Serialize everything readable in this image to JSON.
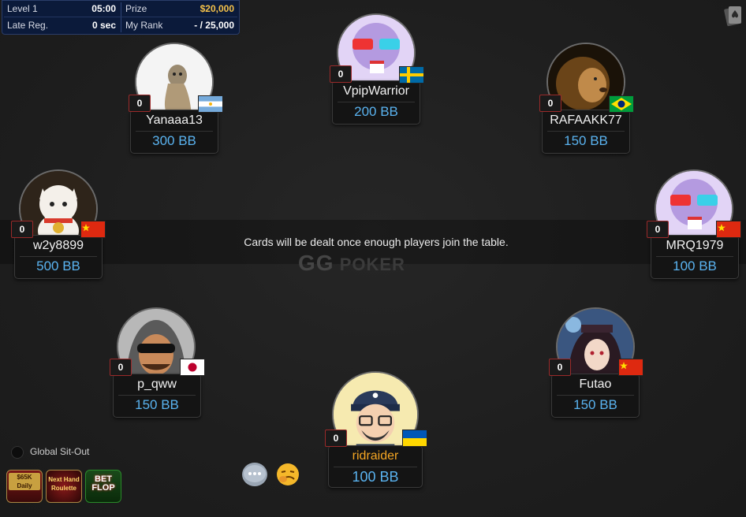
{
  "info": {
    "level_label": "Level 1",
    "level_time": "05:00",
    "late_reg_label": "Late Reg.",
    "late_reg_value": "0 sec",
    "prize_label": "Prize",
    "prize_value": "$20,000",
    "rank_label": "My Rank",
    "rank_value": "- / 25,000"
  },
  "message": "Cards will be dealt once enough players join the table.",
  "watermark": {
    "gg": "GG",
    "poker": "POKER"
  },
  "seats": [
    {
      "name": "Yanaaa13",
      "stack": "300 BB",
      "badge": "0",
      "flag": "argentina"
    },
    {
      "name": "VpipWarrior",
      "stack": "200 BB",
      "badge": "0",
      "flag": "sweden"
    },
    {
      "name": "RAFAAKK77",
      "stack": "150 BB",
      "badge": "0",
      "flag": "brazil"
    },
    {
      "name": "w2y8899",
      "stack": "500 BB",
      "badge": "0",
      "flag": "china"
    },
    {
      "name": "MRQ1979",
      "stack": "100 BB",
      "badge": "0",
      "flag": "china"
    },
    {
      "name": "p_qww",
      "stack": "150 BB",
      "badge": "0",
      "flag": "japan"
    },
    {
      "name": "Futao",
      "stack": "150 BB",
      "badge": "0",
      "flag": "china"
    },
    {
      "name": "ridraider",
      "stack": "100 BB",
      "badge": "0",
      "flag": "ukraine",
      "hero": true
    }
  ],
  "global_sitout": "Global Sit-Out",
  "promos": [
    {
      "text": "$65K Daily",
      "icon": "daily-prize-icon"
    },
    {
      "text": "Next Hand Roulette",
      "icon": "roulette-icon"
    },
    {
      "text": "BET FLOP",
      "icon": "bet-flop-icon"
    }
  ],
  "colors": {
    "stack": "#5ab3f0",
    "hero_name": "#f5a623",
    "prize": "#f5c24a",
    "panel": "#0b1a3a"
  }
}
